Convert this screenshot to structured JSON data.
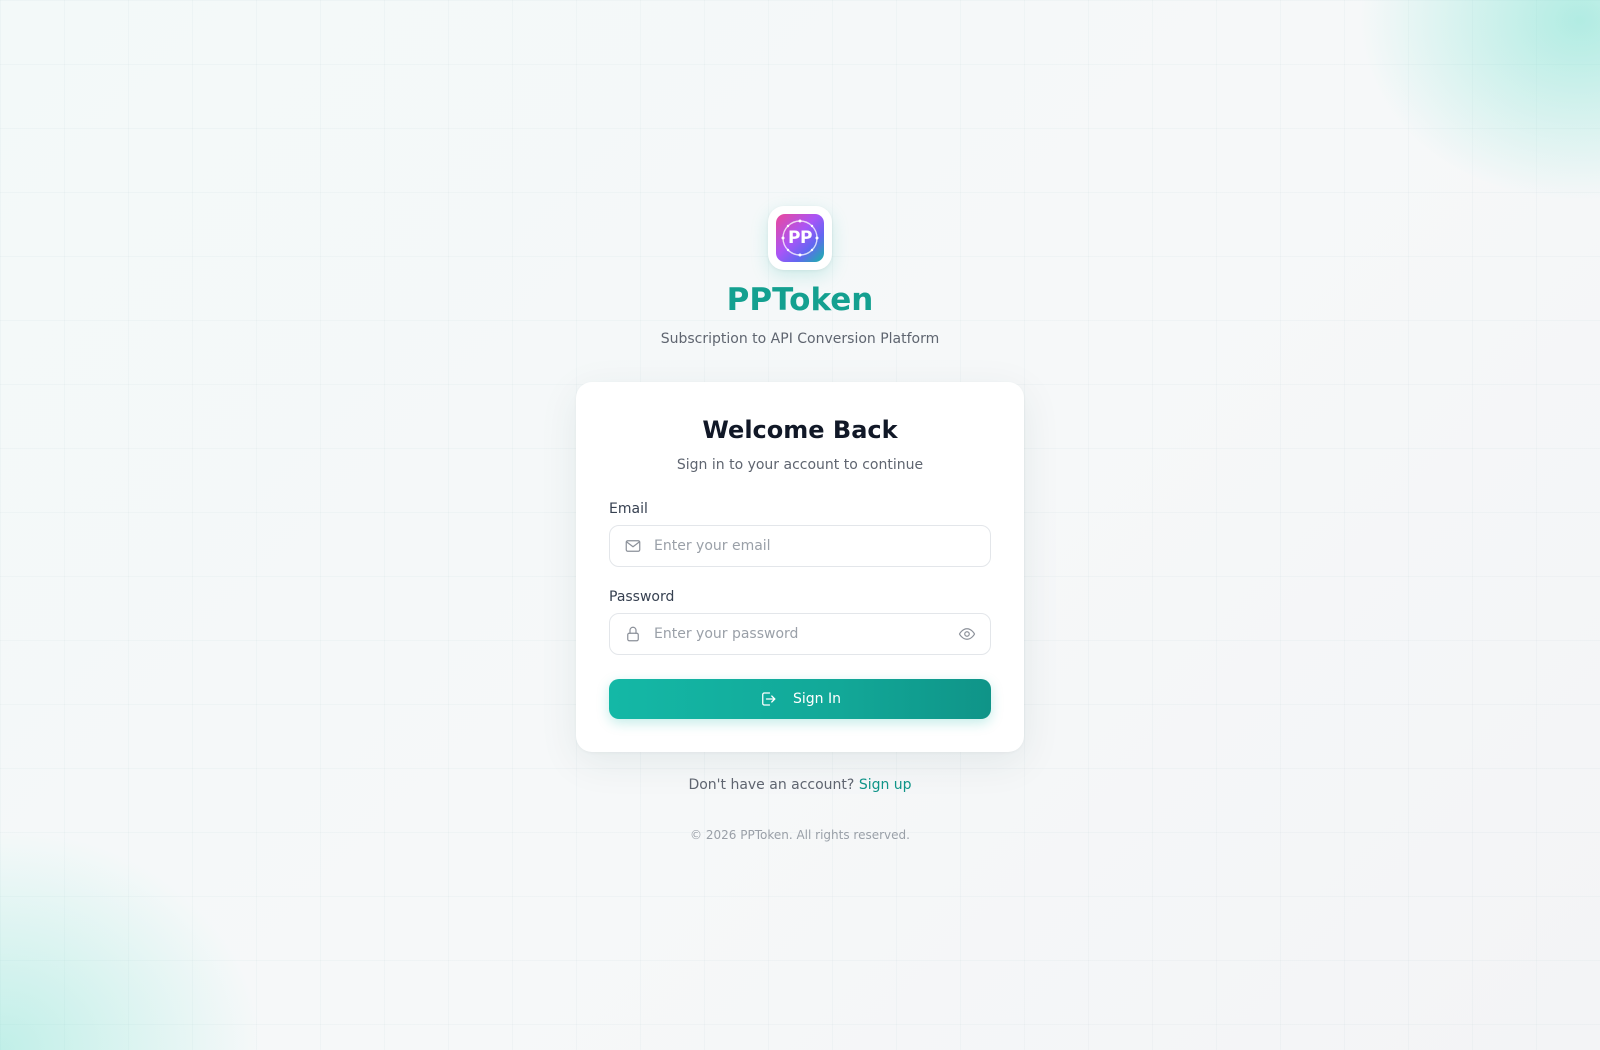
{
  "brand": {
    "logo_text": "PP",
    "name": "PPToken",
    "tagline": "Subscription to API Conversion Platform"
  },
  "card": {
    "title": "Welcome Back",
    "subtitle": "Sign in to your account to continue",
    "email": {
      "label": "Email",
      "value": "",
      "placeholder": "Enter your email",
      "icon": "mail-icon"
    },
    "password": {
      "label": "Password",
      "value": "",
      "placeholder": "Enter your password",
      "icon": "lock-icon",
      "toggle_icon": "eye-icon"
    },
    "submit": {
      "label": "Sign In",
      "icon": "log-in-icon"
    }
  },
  "signup": {
    "prompt": "Don't have an account?",
    "link_label": "Sign up"
  },
  "footer": {
    "copyright": "© 2026 PPToken. All rights reserved."
  },
  "colors": {
    "accent": "#14b8a6",
    "brand_text": "#14a090",
    "link": "#0f9488",
    "title_text": "#111827",
    "muted_text": "#5f6570"
  }
}
